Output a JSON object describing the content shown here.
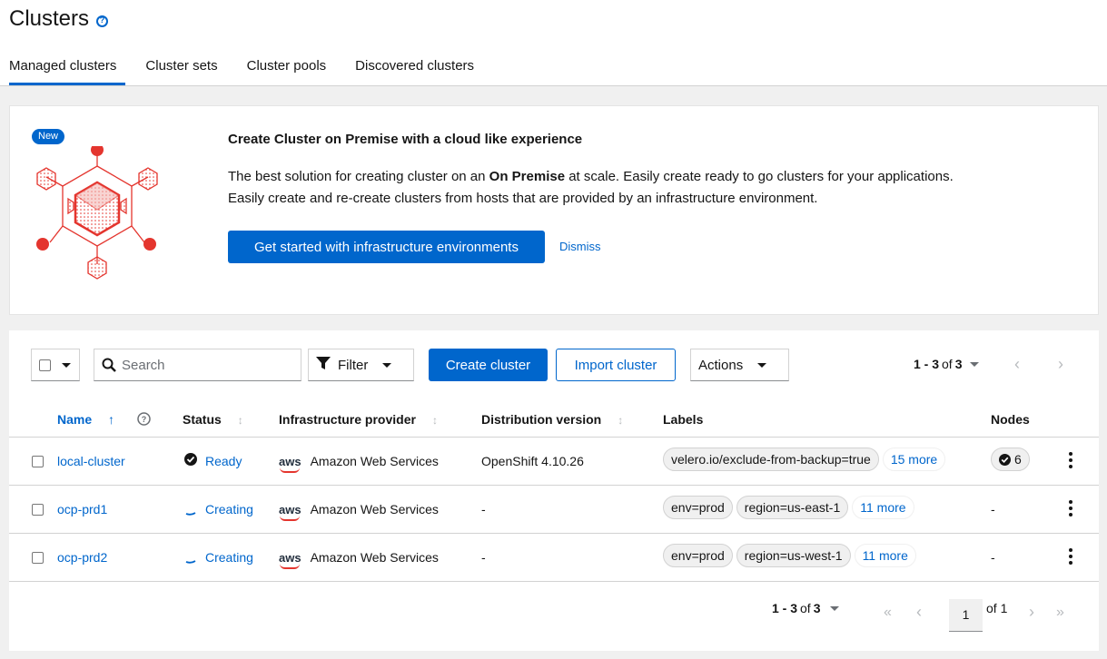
{
  "header": {
    "title": "Clusters",
    "tabs": [
      {
        "label": "Managed clusters",
        "active": true
      },
      {
        "label": "Cluster sets"
      },
      {
        "label": "Cluster pools"
      },
      {
        "label": "Discovered clusters"
      }
    ]
  },
  "banner": {
    "badge": "New",
    "title": "Create Cluster on Premise with a cloud like experience",
    "desc_line1_pre": "The best solution for creating cluster on an ",
    "desc_line1_bold": "On Premise",
    "desc_line1_post": " at scale. Easily create ready to go clusters for your applications.",
    "desc_line2": "Easily create and re-create clusters from hosts that are provided by an infrastructure environment.",
    "cta_label": "Get started with infrastructure environments",
    "dismiss_label": "Dismiss"
  },
  "toolbar": {
    "search_placeholder": "Search",
    "filter_label": "Filter",
    "create_label": "Create cluster",
    "import_label": "Import cluster",
    "actions_label": "Actions",
    "pagination": {
      "range": "1 - 3",
      "of_label": "of",
      "total": "3"
    }
  },
  "table": {
    "columns": [
      "Name",
      "Status",
      "Infrastructure provider",
      "Distribution version",
      "Labels",
      "Nodes"
    ],
    "rows": [
      {
        "name": "local-cluster",
        "status": "Ready",
        "provider_logo": "aws",
        "provider": "Amazon Web Services",
        "version": "OpenShift 4.10.26",
        "labels": [
          "velero.io/exclude-from-backup=true"
        ],
        "more": "15 more",
        "nodes": "6"
      },
      {
        "name": "ocp-prd1",
        "status": "Creating",
        "provider_logo": "aws",
        "provider": "Amazon Web Services",
        "version": "-",
        "labels": [
          "env=prod",
          "region=us-east-1"
        ],
        "more": "11 more",
        "nodes": "-"
      },
      {
        "name": "ocp-prd2",
        "status": "Creating",
        "provider_logo": "aws",
        "provider": "Amazon Web Services",
        "version": "-",
        "labels": [
          "env=prod",
          "region=us-west-1"
        ],
        "more": "11 more",
        "nodes": "-"
      }
    ]
  },
  "footer_pagination": {
    "range": "1 - 3",
    "of_label": "of",
    "total": "3",
    "page": "1",
    "of_pages": "of 1"
  },
  "colors": {
    "accent": "#0066cc",
    "illustration": "#e4352e"
  }
}
